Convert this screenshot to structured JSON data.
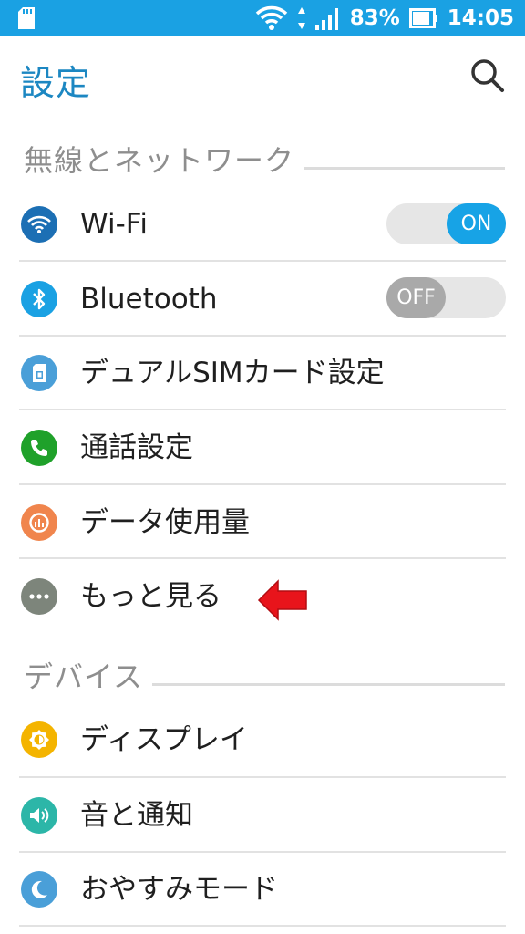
{
  "status_bar": {
    "battery_percent": "83%",
    "time": "14:05",
    "icons": [
      "sd-card-icon",
      "wifi-icon",
      "data-arrows-icon",
      "signal-icon",
      "battery-icon"
    ]
  },
  "app_bar": {
    "title": "設定",
    "search_icon": "search-icon"
  },
  "sections": [
    {
      "title": "無線とネットワーク",
      "items": [
        {
          "label": "Wi-Fi",
          "icon": "wifi-icon",
          "color": "#1c6fb4",
          "toggle": "ON"
        },
        {
          "label": "Bluetooth",
          "icon": "bluetooth-icon",
          "color": "#1aa1e3",
          "toggle": "OFF"
        },
        {
          "label": "デュアルSIMカード設定",
          "icon": "sim-card-icon",
          "color": "#4a9fd8"
        },
        {
          "label": "通話設定",
          "icon": "phone-icon",
          "color": "#1fa12a"
        },
        {
          "label": "データ使用量",
          "icon": "data-usage-icon",
          "color": "#f0854d"
        },
        {
          "label": "もっと見る",
          "icon": "more-icon",
          "color": "#7d857b"
        }
      ]
    },
    {
      "title": "デバイス",
      "items": [
        {
          "label": "ディスプレイ",
          "icon": "brightness-icon",
          "color": "#f4b400"
        },
        {
          "label": "音と通知",
          "icon": "volume-icon",
          "color": "#2cb6a8"
        },
        {
          "label": "おやすみモード",
          "icon": "moon-icon",
          "color": "#4a9fd8"
        }
      ]
    }
  ],
  "annotation": {
    "icon": "red-arrow-icon",
    "color": "#e8141b"
  }
}
